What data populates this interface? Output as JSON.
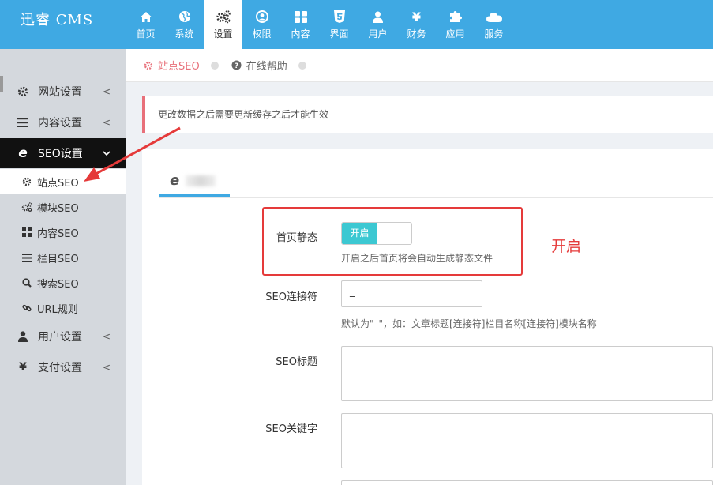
{
  "app": {
    "title": "迅睿 CMS"
  },
  "topnav": [
    {
      "label": "首页",
      "icon": "home-icon"
    },
    {
      "label": "系统",
      "icon": "globe-icon"
    },
    {
      "label": "设置",
      "icon": "gears-icon",
      "active": true
    },
    {
      "label": "权限",
      "icon": "user-circle-icon"
    },
    {
      "label": "内容",
      "icon": "grid-icon"
    },
    {
      "label": "界面",
      "icon": "html5-icon"
    },
    {
      "label": "用户",
      "icon": "user-icon"
    },
    {
      "label": "财务",
      "icon": "yen-icon"
    },
    {
      "label": "应用",
      "icon": "puzzle-icon"
    },
    {
      "label": "服务",
      "icon": "cloud-icon"
    }
  ],
  "sidebar": {
    "items": [
      {
        "label": "网站设置",
        "icon": "gear-icon"
      },
      {
        "label": "内容设置",
        "icon": "bars-icon"
      },
      {
        "label": "SEO设置",
        "icon": "ie-icon",
        "active": true
      },
      {
        "label": "用户设置",
        "icon": "user-icon"
      },
      {
        "label": "支付设置",
        "icon": "yen-icon"
      }
    ],
    "sub_items": [
      {
        "label": "站点SEO",
        "icon": "gear-icon",
        "active": true
      },
      {
        "label": "模块SEO",
        "icon": "gears-icon"
      },
      {
        "label": "内容SEO",
        "icon": "grid-icon"
      },
      {
        "label": "栏目SEO",
        "icon": "list-icon"
      },
      {
        "label": "搜索SEO",
        "icon": "search-icon"
      },
      {
        "label": "URL规则",
        "icon": "link-icon"
      }
    ]
  },
  "breadcrumb": [
    {
      "label": "站点SEO",
      "icon": "gear-icon"
    },
    {
      "label": "在线帮助",
      "icon": "question-icon"
    }
  ],
  "notice": "更改数据之后需要更新缓存之后才能生效",
  "form": {
    "static": {
      "label": "首页静态",
      "toggle_on": "开启",
      "help": "开启之后首页将会自动生成静态文件"
    },
    "connector": {
      "label": "SEO连接符",
      "value": "_",
      "help": "默认为\"_\"，如：文章标题[连接符]栏目名称[连接符]模块名称"
    },
    "seo_title": {
      "label": "SEO标题",
      "value": ""
    },
    "seo_keywords": {
      "label": "SEO关键字",
      "value": ""
    }
  },
  "annotation": {
    "text": "开启"
  },
  "colors": {
    "topbar": "#3fa9e3",
    "accent_red": "#e53a3a",
    "toggle_on": "#3cc8d2"
  }
}
